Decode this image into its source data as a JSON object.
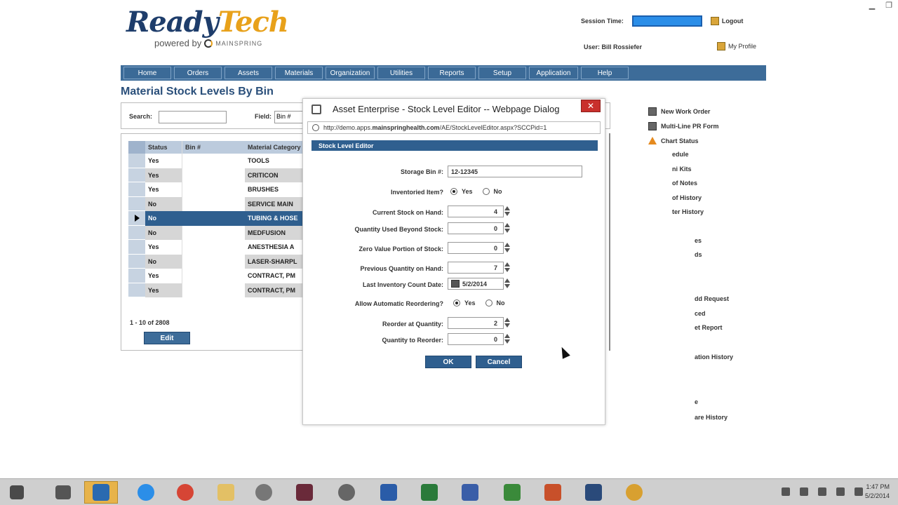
{
  "header": {
    "logo_main_1": "Ready",
    "logo_main_2": "Tech",
    "logo_sub": "powered by",
    "logo_brand": "MAINSPRING",
    "session_label": "Session Time:",
    "logout": "Logout",
    "user_label": "User: Bill Rossiefer",
    "my_profile": "My Profile"
  },
  "nav": [
    "Home",
    "Orders",
    "Assets",
    "Materials",
    "Organization",
    "Utilities",
    "Reports",
    "Setup",
    "Application",
    "Help"
  ],
  "page_title": "Material Stock Levels By Bin",
  "search": {
    "label": "Search:",
    "value": "",
    "field_label": "Field:",
    "field_value": "Bin #"
  },
  "grid": {
    "columns": [
      "Status",
      "Bin #",
      "Material Category"
    ],
    "rows": [
      {
        "status": "Yes",
        "bin": "",
        "category": "TOOLS"
      },
      {
        "status": "Yes",
        "bin": "",
        "category": "CRITICON"
      },
      {
        "status": "Yes",
        "bin": "",
        "category": "BRUSHES"
      },
      {
        "status": "No",
        "bin": "",
        "category": "SERVICE MAIN"
      },
      {
        "status": "No",
        "bin": "",
        "category": "TUBING & HOSE"
      },
      {
        "status": "No",
        "bin": "",
        "category": "MEDFUSION"
      },
      {
        "status": "Yes",
        "bin": "",
        "category": "ANESTHESIA A"
      },
      {
        "status": "No",
        "bin": "",
        "category": "LASER-SHARPL"
      },
      {
        "status": "Yes",
        "bin": "",
        "category": "CONTRACT, PM"
      },
      {
        "status": "Yes",
        "bin": "",
        "category": "CONTRACT, PM"
      }
    ],
    "pager": "1 - 10 of 2808",
    "edit_label": "Edit"
  },
  "side_links": [
    {
      "label": "New Work Order",
      "icon": "document-icon"
    },
    {
      "label": "Multi-Line PR Form",
      "icon": "checklist-icon"
    },
    {
      "label": "Chart Status",
      "icon": "warning-icon"
    }
  ],
  "side_fragments": [
    "edule",
    "ni Kits",
    "of Notes",
    "of History",
    "ter History",
    "es",
    "ds",
    "dd Request",
    "ced",
    "et Report",
    "ation History",
    "e",
    "are History"
  ],
  "dialog": {
    "title": "Asset Enterprise - Stock Level Editor -- Webpage Dialog",
    "close": "✕",
    "url_prefix": "http://demo.apps.",
    "url_bold": "mainspringhealth.com",
    "url_rest": "/AE/StockLevelEditor.aspx?SCCPid=1",
    "section": "Stock Level Editor",
    "fields": {
      "storage_bin_label": "Storage Bin #:",
      "storage_bin_value": "12-12345",
      "inventoried_label": "Inventoried Item?",
      "inventoried_yes": "Yes",
      "inventoried_no": "No",
      "current_stock_label": "Current Stock on Hand:",
      "current_stock_value": "4",
      "qty_used_label": "Quantity Used Beyond Stock:",
      "qty_used_value": "0",
      "zero_value_label": "Zero Value Portion of Stock:",
      "zero_value_value": "0",
      "prev_qty_label": "Previous Quantity on Hand:",
      "prev_qty_value": "7",
      "last_count_label": "Last Inventory Count Date:",
      "last_count_value": "5/2/2014",
      "auto_reorder_label": "Allow Automatic Reordering?",
      "auto_reorder_yes": "Yes",
      "auto_reorder_no": "No",
      "reorder_qty_label": "Reorder at Quantity:",
      "reorder_qty_value": "2",
      "qty_reorder_label": "Quantity to Reorder:",
      "qty_reorder_value": "0"
    },
    "ok": "OK",
    "cancel": "Cancel"
  },
  "taskbar": {
    "time": "1:47 PM",
    "date": "5/2/2014"
  },
  "colors": {
    "nav_blue": "#3d6c99",
    "dialog_section": "#2f5f8f",
    "session_bar": "#2b8ee8",
    "close_red": "#c9302c",
    "logo_accent": "#e8a11a"
  }
}
